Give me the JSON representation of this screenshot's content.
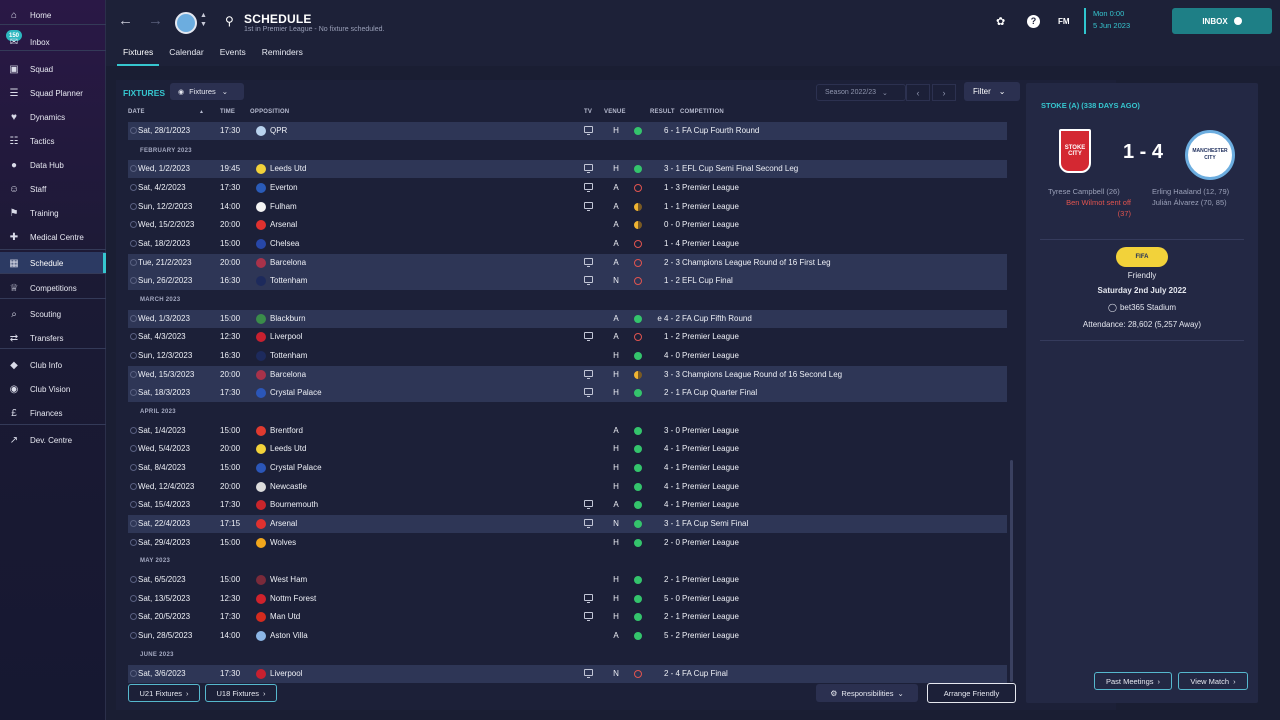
{
  "sidebar": {
    "inbox_badge": "150",
    "items": [
      {
        "label": "Home",
        "icon": "home-icon"
      },
      {
        "label": "Inbox",
        "icon": "inbox-icon"
      },
      {
        "label": "Squad",
        "icon": "shirt-icon"
      },
      {
        "label": "Squad Planner",
        "icon": "planner-icon"
      },
      {
        "label": "Dynamics",
        "icon": "dynamics-icon"
      },
      {
        "label": "Tactics",
        "icon": "tactics-icon"
      },
      {
        "label": "Data Hub",
        "icon": "data-hub-icon"
      },
      {
        "label": "Staff",
        "icon": "staff-icon"
      },
      {
        "label": "Training",
        "icon": "training-icon"
      },
      {
        "label": "Medical Centre",
        "icon": "medical-icon"
      },
      {
        "label": "Schedule",
        "icon": "schedule-icon"
      },
      {
        "label": "Competitions",
        "icon": "trophy-icon"
      },
      {
        "label": "Scouting",
        "icon": "scouting-icon"
      },
      {
        "label": "Transfers",
        "icon": "transfers-icon"
      },
      {
        "label": "Club Info",
        "icon": "shield-icon"
      },
      {
        "label": "Club Vision",
        "icon": "vision-icon"
      },
      {
        "label": "Finances",
        "icon": "finances-icon"
      },
      {
        "label": "Dev. Centre",
        "icon": "dev-centre-icon"
      }
    ]
  },
  "header": {
    "title": "SCHEDULE",
    "subtitle": "1st in Premier League - No fixture scheduled.",
    "tabs": [
      "Fixtures",
      "Calendar",
      "Events",
      "Reminders"
    ],
    "fm_label": "FM",
    "date_line1": "Mon 0:00",
    "date_line2": "5 Jun 2023",
    "inbox_label": "INBOX"
  },
  "fixtures": {
    "section_title": "FIXTURES",
    "view_dropdown": "Fixtures",
    "season": "Season 2022/23",
    "filter_label": "Filter",
    "columns": {
      "date": "DATE",
      "time": "TIME",
      "opposition": "OPPOSITION",
      "tv": "TV",
      "venue": "VENUE",
      "result": "RESULT",
      "competition": "COMPETITION"
    },
    "months": [
      "FEBRUARY 2023",
      "MARCH 2023",
      "APRIL 2023",
      "MAY 2023",
      "JUNE 2023"
    ],
    "rows": [
      {
        "date": "Sat, 28/1/2023",
        "time": "17:30",
        "opp": "QPR",
        "tv": true,
        "venue": "H",
        "res": "W",
        "score": "6 - 1",
        "comp": "FA Cup Fourth Round",
        "crest": "#b9d3ee"
      },
      {
        "date": "Wed, 1/2/2023",
        "time": "19:45",
        "opp": "Leeds Utd",
        "tv": true,
        "venue": "H",
        "res": "W",
        "score": "3 - 1",
        "comp": "EFL Cup Semi Final Second Leg",
        "crest": "#f2d23a"
      },
      {
        "date": "Sat, 4/2/2023",
        "time": "17:30",
        "opp": "Everton",
        "tv": true,
        "venue": "A",
        "res": "L",
        "score": "1 - 3",
        "comp": "Premier League",
        "crest": "#2a5bb8"
      },
      {
        "date": "Sun, 12/2/2023",
        "time": "14:00",
        "opp": "Fulham",
        "tv": true,
        "venue": "A",
        "res": "D",
        "score": "1 - 1",
        "comp": "Premier League",
        "crest": "#f4f4f4"
      },
      {
        "date": "Wed, 15/2/2023",
        "time": "20:00",
        "opp": "Arsenal",
        "tv": false,
        "venue": "A",
        "res": "D",
        "score": "0 - 0",
        "comp": "Premier League",
        "crest": "#e0312f"
      },
      {
        "date": "Sat, 18/2/2023",
        "time": "15:00",
        "opp": "Chelsea",
        "tv": false,
        "venue": "A",
        "res": "L",
        "score": "1 - 4",
        "comp": "Premier League",
        "crest": "#2747a8"
      },
      {
        "date": "Tue, 21/2/2023",
        "time": "20:00",
        "opp": "Barcelona",
        "tv": true,
        "venue": "A",
        "res": "L",
        "score": "2 - 3",
        "comp": "Champions League Round of 16 First Leg",
        "crest": "#a8324a"
      },
      {
        "date": "Sun, 26/2/2023",
        "time": "16:30",
        "opp": "Tottenham",
        "tv": true,
        "venue": "N",
        "res": "L",
        "score": "1 - 2",
        "comp": "EFL Cup Final",
        "crest": "#1d2a5c"
      },
      {
        "date": "Wed, 1/3/2023",
        "time": "15:00",
        "opp": "Blackburn",
        "tv": false,
        "venue": "A",
        "res": "W",
        "score": "e 4 - 2",
        "comp": "FA Cup Fifth Round",
        "crest": "#3a8c4a"
      },
      {
        "date": "Sat, 4/3/2023",
        "time": "12:30",
        "opp": "Liverpool",
        "tv": true,
        "venue": "A",
        "res": "L",
        "score": "1 - 2",
        "comp": "Premier League",
        "crest": "#c8202f"
      },
      {
        "date": "Sun, 12/3/2023",
        "time": "16:30",
        "opp": "Tottenham",
        "tv": false,
        "venue": "H",
        "res": "W",
        "score": "4 - 0",
        "comp": "Premier League",
        "crest": "#1d2a5c"
      },
      {
        "date": "Wed, 15/3/2023",
        "time": "20:00",
        "opp": "Barcelona",
        "tv": true,
        "venue": "H",
        "res": "D",
        "score": "3 - 3",
        "comp": "Champions League Round of 16 Second Leg",
        "crest": "#a8324a"
      },
      {
        "date": "Sat, 18/3/2023",
        "time": "17:30",
        "opp": "Crystal Palace",
        "tv": true,
        "venue": "H",
        "res": "W",
        "score": "2 - 1",
        "comp": "FA Cup Quarter Final",
        "crest": "#2b56b8"
      },
      {
        "date": "Sat, 1/4/2023",
        "time": "15:00",
        "opp": "Brentford",
        "tv": false,
        "venue": "A",
        "res": "W",
        "score": "3 - 0",
        "comp": "Premier League",
        "crest": "#e03a2f"
      },
      {
        "date": "Wed, 5/4/2023",
        "time": "20:00",
        "opp": "Leeds Utd",
        "tv": false,
        "venue": "H",
        "res": "W",
        "score": "4 - 1",
        "comp": "Premier League",
        "crest": "#f2d23a"
      },
      {
        "date": "Sat, 8/4/2023",
        "time": "15:00",
        "opp": "Crystal Palace",
        "tv": false,
        "venue": "H",
        "res": "W",
        "score": "4 - 1",
        "comp": "Premier League",
        "crest": "#2b56b8"
      },
      {
        "date": "Wed, 12/4/2023",
        "time": "20:00",
        "opp": "Newcastle",
        "tv": false,
        "venue": "H",
        "res": "W",
        "score": "4 - 1",
        "comp": "Premier League",
        "crest": "#dcdcdc"
      },
      {
        "date": "Sat, 15/4/2023",
        "time": "17:30",
        "opp": "Bournemouth",
        "tv": true,
        "venue": "A",
        "res": "W",
        "score": "4 - 1",
        "comp": "Premier League",
        "crest": "#c9252b"
      },
      {
        "date": "Sat, 22/4/2023",
        "time": "17:15",
        "opp": "Arsenal",
        "tv": true,
        "venue": "N",
        "res": "W",
        "score": "3 - 1",
        "comp": "FA Cup Semi Final",
        "crest": "#e0312f"
      },
      {
        "date": "Sat, 29/4/2023",
        "time": "15:00",
        "opp": "Wolves",
        "tv": false,
        "venue": "H",
        "res": "W",
        "score": "2 - 0",
        "comp": "Premier League",
        "crest": "#f2a71c"
      },
      {
        "date": "Sat, 6/5/2023",
        "time": "15:00",
        "opp": "West Ham",
        "tv": false,
        "venue": "H",
        "res": "W",
        "score": "2 - 1",
        "comp": "Premier League",
        "crest": "#7a2a3a"
      },
      {
        "date": "Sat, 13/5/2023",
        "time": "12:30",
        "opp": "Nottm Forest",
        "tv": true,
        "venue": "H",
        "res": "W",
        "score": "5 - 0",
        "comp": "Premier League",
        "crest": "#d0222c"
      },
      {
        "date": "Sat, 20/5/2023",
        "time": "17:30",
        "opp": "Man Utd",
        "tv": true,
        "venue": "H",
        "res": "W",
        "score": "2 - 1",
        "comp": "Premier League",
        "crest": "#d52b1e"
      },
      {
        "date": "Sun, 28/5/2023",
        "time": "14:00",
        "opp": "Aston Villa",
        "tv": false,
        "venue": "A",
        "res": "W",
        "score": "5 - 2",
        "comp": "Premier League",
        "crest": "#8cb6e6"
      },
      {
        "date": "Sat, 3/6/2023",
        "time": "17:30",
        "opp": "Liverpool",
        "tv": true,
        "venue": "N",
        "res": "L",
        "score": "2 - 4",
        "comp": "FA Cup Final",
        "crest": "#c8202f"
      }
    ],
    "u21_button": "U21 Fixtures",
    "u18_button": "U18 Fixtures",
    "responsibilities_button": "Responsibilities",
    "arrange_button": "Arrange Friendly"
  },
  "match_panel": {
    "title": "STOKE (A) (338 DAYS AGO)",
    "score": "1 - 4",
    "home_badge_text": "STOKE CITY",
    "away_badge_text": "MANCHESTER CITY",
    "home_scorer": "Tyrese Campbell (26)",
    "home_sent_off": "Ben Wilmot sent off (37)",
    "away_scorer_1": "Erling Haaland (12, 79)",
    "away_scorer_2": "Julián Álvarez (70, 85)",
    "competition_badge": "FIFA",
    "competition": "Friendly",
    "date": "Saturday 2nd July 2022",
    "stadium": "bet365 Stadium",
    "attendance": "Attendance: 28,602 (5,257 Away)",
    "past_meetings_button": "Past Meetings",
    "view_match_button": "View Match"
  },
  "colors": {
    "accent": "#36c6cf",
    "win": "#34c46c",
    "loss": "#e0544f",
    "draw": "#f0b432",
    "row_highlight": "#2e3656"
  }
}
